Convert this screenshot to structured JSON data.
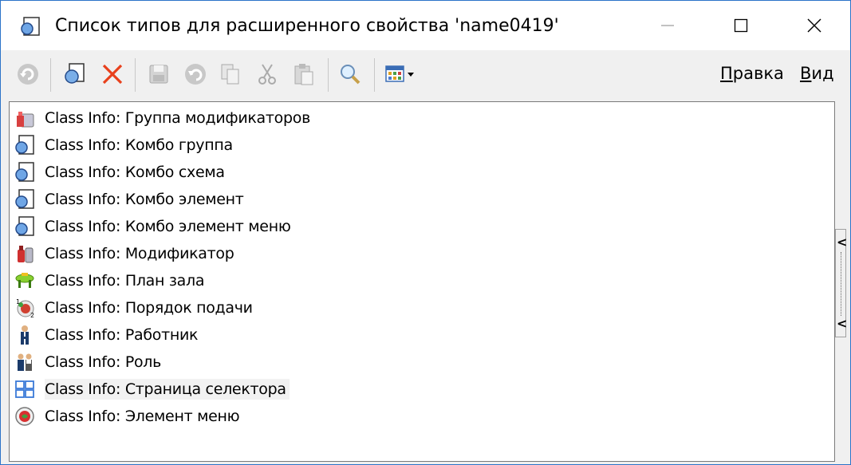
{
  "window": {
    "title": "Список типов для расширенного свойства 'name0419'"
  },
  "menu": {
    "edit_first": "П",
    "edit_rest": "равка",
    "view_first": "В",
    "view_rest": "ид"
  },
  "toolbar": {
    "buttons": [
      "refresh-icon",
      "new-icon",
      "delete-icon",
      "save-icon",
      "undo-icon",
      "copy-icon",
      "cut-icon",
      "paste-icon",
      "search-icon",
      "view-grid-dropdown-icon"
    ]
  },
  "list": {
    "items": [
      {
        "label": "Class Info: Группа модификаторов",
        "icon": "modifier-group-icon"
      },
      {
        "label": "Class Info: Комбо группа",
        "icon": "combo-icon"
      },
      {
        "label": "Class Info: Комбо схема",
        "icon": "combo-icon"
      },
      {
        "label": "Class Info: Комбо элемент",
        "icon": "combo-icon"
      },
      {
        "label": "Class Info: Комбо элемент меню",
        "icon": "combo-icon"
      },
      {
        "label": "Class Info: Модификатор",
        "icon": "modifier-icon"
      },
      {
        "label": "Class Info: План зала",
        "icon": "hall-plan-icon"
      },
      {
        "label": "Class Info: Порядок подачи",
        "icon": "serving-order-icon"
      },
      {
        "label": "Class Info: Работник",
        "icon": "employee-icon"
      },
      {
        "label": "Class Info: Роль",
        "icon": "role-icon"
      },
      {
        "label": "Class Info: Страница селектора",
        "icon": "selector-page-icon"
      },
      {
        "label": "Class Info: Элемент меню",
        "icon": "menu-item-icon"
      }
    ],
    "selected_index": 10
  },
  "handle": {
    "arrow_top": "<",
    "arrow_bottom": "<"
  },
  "colors": {
    "accent": "#2b73c9",
    "list_background": "#ffffff",
    "toolbar_background": "#f0f0f0",
    "delete_red": "#e8401c"
  }
}
